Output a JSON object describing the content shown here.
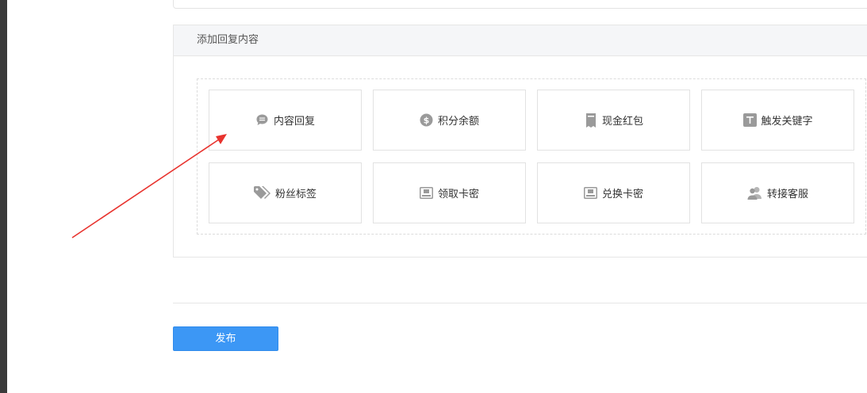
{
  "reply_section": {
    "title": "添加回复内容",
    "options": [
      {
        "label": "内容回复",
        "icon": "chat-bubble-icon"
      },
      {
        "label": "积分余额",
        "icon": "dollar-coin-icon"
      },
      {
        "label": "现金红包",
        "icon": "red-packet-icon"
      },
      {
        "label": "触发关键字",
        "icon": "text-t-icon"
      },
      {
        "label": "粉丝标签",
        "icon": "tag-icon"
      },
      {
        "label": "领取卡密",
        "icon": "card-icon"
      },
      {
        "label": "兑换卡密",
        "icon": "card-icon"
      },
      {
        "label": "转接客服",
        "icon": "users-icon"
      }
    ]
  },
  "actions": {
    "publish_label": "发布"
  },
  "colors": {
    "accent": "#3c97f5",
    "annotation_arrow": "#e8332e",
    "icon_gray": "#9a9a9a"
  }
}
